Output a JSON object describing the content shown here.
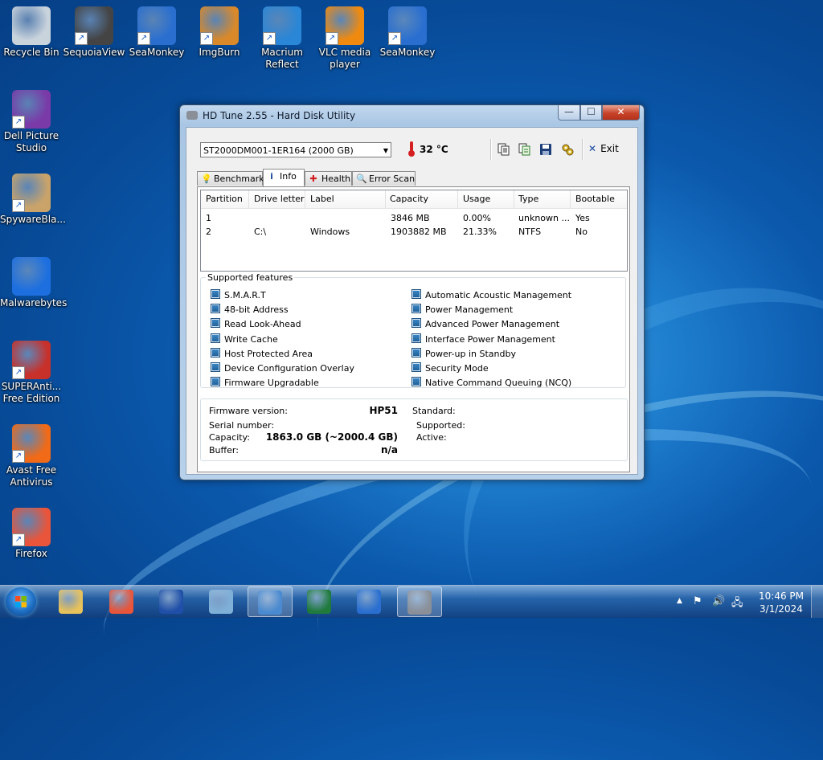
{
  "desktop_icons": [
    {
      "label": "Recycle Bin",
      "icon": "recycle-bin-icon",
      "shortcut": false,
      "color": "#c9d3dc"
    },
    {
      "label": "SequoiaView",
      "icon": "sequoiaview-icon",
      "shortcut": true,
      "color": "#444444"
    },
    {
      "label": "SeaMonkey",
      "icon": "seamonkey-icon",
      "shortcut": true,
      "color": "#2a6fd0"
    },
    {
      "label": "ImgBurn",
      "icon": "imgburn-icon",
      "shortcut": true,
      "color": "#d9892a"
    },
    {
      "label": "Macrium Reflect",
      "icon": "macrium-reflect-icon",
      "shortcut": true,
      "color": "#2a86d6"
    },
    {
      "label": "VLC media player",
      "icon": "vlc-icon",
      "shortcut": true,
      "color": "#f08a0e"
    },
    {
      "label": "SeaMonkey",
      "icon": "seamonkey-icon",
      "shortcut": true,
      "color": "#2a6fd0"
    },
    {
      "label": "Dell Picture Studio",
      "icon": "dell-picture-studio-icon",
      "shortcut": true,
      "color": "#7a3aa8"
    },
    {
      "label": "SpywareBla...",
      "icon": "spywareblaster-icon",
      "shortcut": true,
      "color": "#c9a36a"
    },
    {
      "label": "Malwarebytes",
      "icon": "malwarebytes-icon",
      "shortcut": false,
      "color": "#1d6fe0"
    },
    {
      "label": "SUPERAnti... Free Edition",
      "icon": "superantispyware-icon",
      "shortcut": true,
      "color": "#c8302a"
    },
    {
      "label": "Avast Free Antivirus",
      "icon": "avast-icon",
      "shortcut": true,
      "color": "#f06a17"
    },
    {
      "label": "Firefox",
      "icon": "firefox-icon",
      "shortcut": true,
      "color": "#e8553a"
    }
  ],
  "window": {
    "title": "HD Tune 2.55 - Hard Disk Utility",
    "controls": {
      "minimize": "—",
      "maximize": "☐",
      "close": "✕"
    },
    "toolbar": {
      "drive": "ST2000DM001-1ER164 (2000 GB)",
      "temperature": "32 °C",
      "exit_label": "Exit"
    },
    "tabs": [
      {
        "label": "Benchmark",
        "icon": "benchmark-icon",
        "active": false
      },
      {
        "label": "Info",
        "icon": "info-icon",
        "active": true
      },
      {
        "label": "Health",
        "icon": "health-icon",
        "active": false
      },
      {
        "label": "Error Scan",
        "icon": "error-scan-icon",
        "active": false
      }
    ],
    "partitions": {
      "columns": [
        "Partition",
        "Drive letter",
        "Label",
        "Capacity",
        "Usage",
        "Type",
        "Bootable"
      ],
      "rows": [
        [
          "1",
          "",
          "",
          "3846 MB",
          "0.00%",
          "unknown ...",
          "Yes"
        ],
        [
          "2",
          "C:\\",
          "Windows",
          "1903882 MB",
          "21.33%",
          "NTFS",
          "No"
        ]
      ]
    },
    "features": {
      "legend": "Supported features",
      "left": [
        "S.M.A.R.T",
        "48-bit Address",
        "Read Look-Ahead",
        "Write Cache",
        "Host Protected Area",
        "Device Configuration Overlay",
        "Firmware Upgradable"
      ],
      "right": [
        "Automatic Acoustic Management",
        "Power Management",
        "Advanced Power Management",
        "Interface Power Management",
        "Power-up in Standby",
        "Security Mode",
        "Native Command Queuing (NCQ)"
      ]
    },
    "details": {
      "firmware_label": "Firmware version:",
      "firmware_value": "HP51",
      "serial_label": "Serial number:",
      "serial_value": "",
      "capacity_label": "Capacity:",
      "capacity_value": "1863.0 GB (~2000.4 GB)",
      "buffer_label": "Buffer:",
      "buffer_value": "n/a",
      "standard_label": "Standard:",
      "supported_label": "Supported:",
      "active_label": "Active:"
    }
  },
  "taskbar": {
    "pinned": [
      {
        "name": "explorer",
        "icon": "folder-icon",
        "active": false,
        "color": "#e8c25a"
      },
      {
        "name": "firefox",
        "icon": "firefox-icon",
        "active": false,
        "color": "#e8553a"
      },
      {
        "name": "word",
        "icon": "word-icon",
        "active": false,
        "color": "#1f4fa8"
      },
      {
        "name": "paint",
        "icon": "paint-icon",
        "active": false,
        "color": "#7fb0d8"
      },
      {
        "name": "control-panel",
        "icon": "control-panel-icon",
        "active": true,
        "color": "#4a8ad0"
      },
      {
        "name": "excel",
        "icon": "excel-icon",
        "active": false,
        "color": "#1f7a3c"
      },
      {
        "name": "seamonkey",
        "icon": "seamonkey-icon",
        "active": false,
        "color": "#2a6fd0"
      },
      {
        "name": "hd-tune",
        "icon": "hd-tune-icon",
        "active": true,
        "color": "#8a8f98"
      }
    ],
    "time": "10:46 PM",
    "date": "3/1/2024"
  }
}
